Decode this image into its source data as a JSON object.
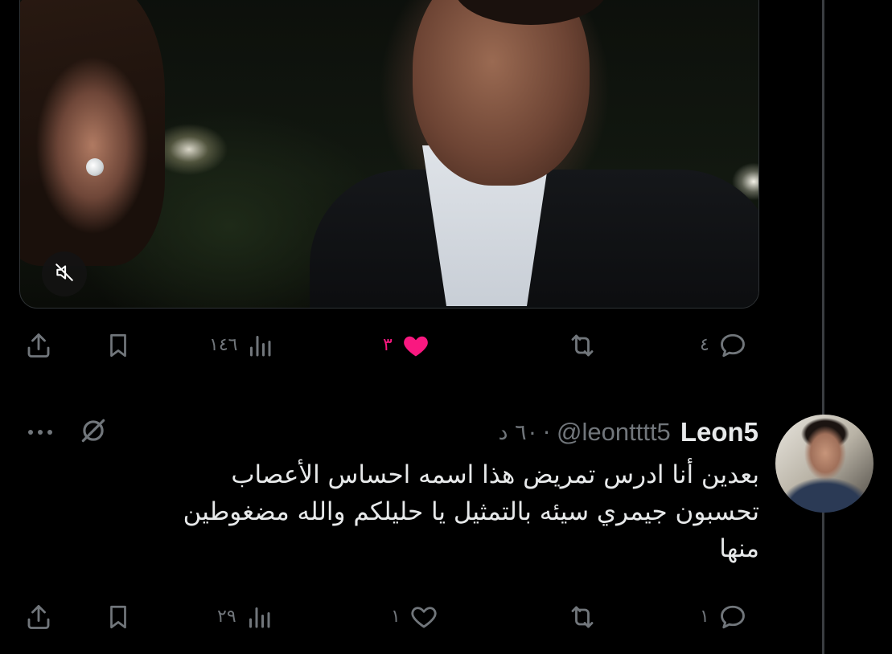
{
  "first_tweet": {
    "media": {
      "mute_label": "mute"
    },
    "actions": {
      "replies": "٤",
      "retweets": "",
      "likes": "٣",
      "views": "١٤٦",
      "liked": true
    }
  },
  "reply_tweet": {
    "display_name": "Leon5",
    "handle": "@leontttt5",
    "separator": "·",
    "time": "٦٠ د",
    "text": "بعدين أنا ادرس تمريض هذا اسمه احساس الأعصاب\nتحسبون جيمري سيئه بالتمثيل يا حليلكم والله مضغوطين\nمنها",
    "actions": {
      "replies": "١",
      "retweets": "",
      "likes": "١",
      "views": "٢٩"
    }
  },
  "colors": {
    "background": "#000000",
    "text": "#e7e9ea",
    "muted": "#71767b",
    "like_active": "#f91880",
    "thread_line": "#3a3d41"
  },
  "icons": [
    "share-icon",
    "bookmark-icon",
    "views-icon",
    "heart-icon",
    "retweet-icon",
    "reply-icon",
    "mute-icon",
    "grok-icon",
    "more-icon"
  ]
}
